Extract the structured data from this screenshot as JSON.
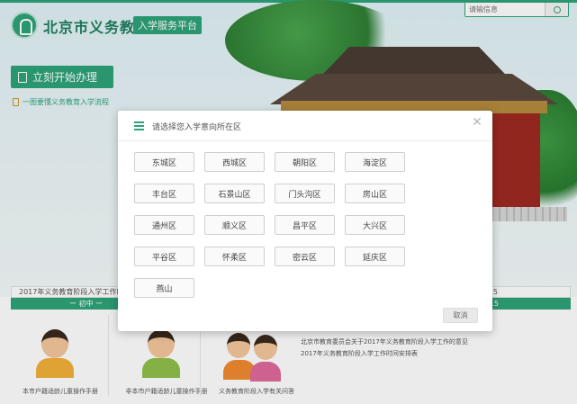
{
  "header": {
    "site_title": "北京市义务教育",
    "site_badge": "入学服务平台",
    "search_placeholder": "请输信息",
    "start_button": "立刻开始办理",
    "guide_link": "一图要懂义务教育入学流程"
  },
  "notice": {
    "text": "2017年义务教育阶段入学工作时",
    "right_text": "15",
    "green_left": "ー 初中 ー",
    "green_right": "15"
  },
  "cards": [
    {
      "caption": "本市户籍适龄儿童操作手册"
    },
    {
      "caption": "非本市户籍适龄儿童操作手册"
    },
    {
      "caption": "义务教育阶段入学有关问答"
    }
  ],
  "news": [
    "北京市教育委员会关于2017年义务教育阶段入学工作的意见",
    "2017年义务教育阶段入学工作时间安排表"
  ],
  "modal": {
    "title": "请选择您入学意向所在区",
    "close_glyph": "✕",
    "cancel_label": "取消",
    "districts": [
      "东城区",
      "西城区",
      "朝阳区",
      "海淀区",
      "丰台区",
      "石景山区",
      "门头沟区",
      "房山区",
      "通州区",
      "顺义区",
      "昌平区",
      "大兴区",
      "平谷区",
      "怀柔区",
      "密云区",
      "延庆区",
      "燕山"
    ]
  },
  "colors": {
    "brand_green": "#2ea37a",
    "overlay": "rgba(0,0,0,0.08)"
  },
  "icons": [
    "logo-icon",
    "search-icon",
    "document-icon",
    "list-icon",
    "close-icon"
  ]
}
